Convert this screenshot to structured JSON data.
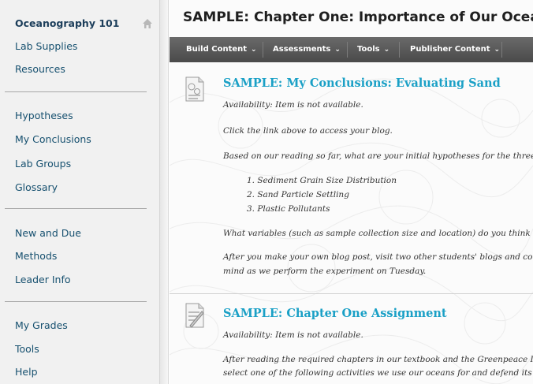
{
  "sidebar": {
    "course_title": "Oceanography 101",
    "items": [
      {
        "label": "Lab Supplies"
      },
      {
        "label": "Resources"
      },
      {
        "label": "Hypotheses"
      },
      {
        "label": "My Conclusions"
      },
      {
        "label": "Lab Groups"
      },
      {
        "label": "Glossary"
      },
      {
        "label": "New and Due"
      },
      {
        "label": "Methods"
      },
      {
        "label": "Leader Info"
      },
      {
        "label": "My Grades"
      },
      {
        "label": "Tools"
      },
      {
        "label": "Help"
      }
    ]
  },
  "main": {
    "page_title": "SAMPLE: Chapter One: Importance of Our Oceans",
    "menu": [
      {
        "label": "Build Content"
      },
      {
        "label": "Assessments"
      },
      {
        "label": "Tools"
      },
      {
        "label": "Publisher Content"
      }
    ],
    "items": [
      {
        "title": "SAMPLE: My Conclusions: Evaluating Sand",
        "availability": "Availability:  Item is not available.",
        "para1": "Click the link above to access your blog.",
        "para2": "Based on our reading so far, what are your initial hypotheses for the three pa",
        "list": [
          "1. Sediment Grain Size Distribution",
          "2. Sand Particle Settling",
          "3. Plastic Pollutants"
        ],
        "para3": "What variables (such as sample collection size and location) do you think will",
        "para4a": "After you make your own blog post, visit two other students' blogs and comme",
        "para4b": "mind as we perform the experiment on Tuesday."
      },
      {
        "title": "SAMPLE: Chapter One Assignment",
        "availability": "Availability:  Item is not available.",
        "para1a": "After reading the required chapters in our textbook and the Greenpeace Inter",
        "para1b": "select one of the following activities we use our oceans for and defend its usag"
      }
    ]
  },
  "colors": {
    "sidebar_bg": "#f1f1f1",
    "nav_link": "#16506f",
    "menubar": "#555555",
    "item_title": "#1aa0c6"
  },
  "icons": [
    "home-icon",
    "blog-icon",
    "assignment-icon",
    "chevron-down-icon"
  ]
}
